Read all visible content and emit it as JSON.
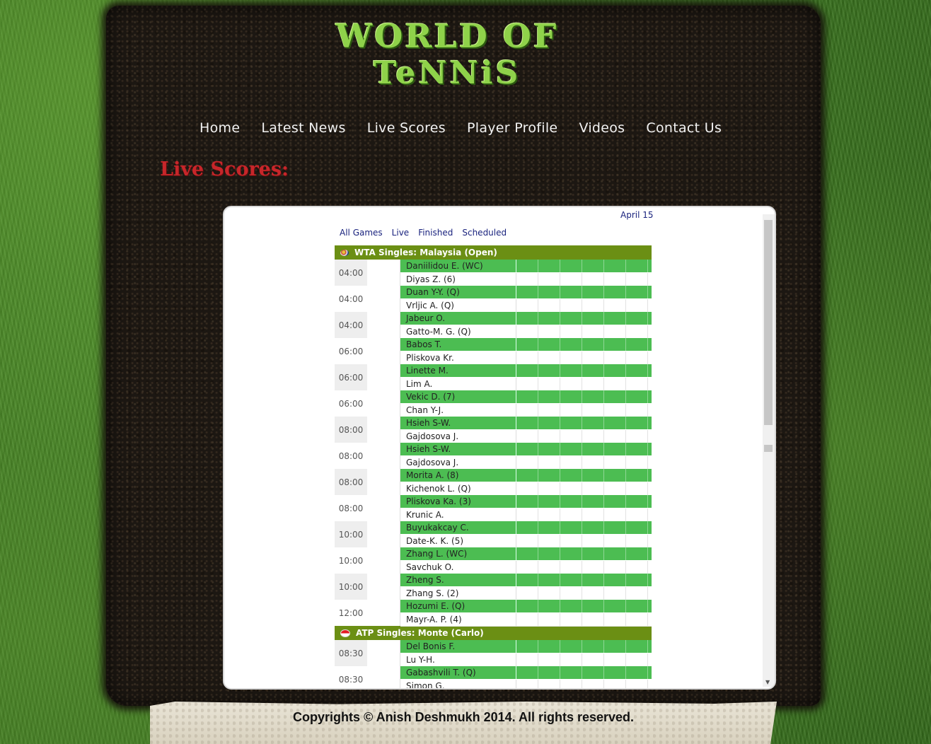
{
  "logo": {
    "line1": "WORLD OF",
    "line2": "TeNNiS"
  },
  "nav": {
    "items": [
      {
        "label": "Home"
      },
      {
        "label": "Latest News"
      },
      {
        "label": "Live Scores"
      },
      {
        "label": "Player Profile"
      },
      {
        "label": "Videos"
      },
      {
        "label": "Contact Us"
      }
    ]
  },
  "page_title": "Live Scores:",
  "widget": {
    "date": "April 15",
    "filters": [
      "All Games",
      "Live",
      "Finished",
      "Scheduled"
    ],
    "sections": [
      {
        "title": "WTA Singles: Malaysia (Open)",
        "flag": "malaysia-flag-icon",
        "matches": [
          {
            "time": "04:00",
            "p1": "Daniilidou E. (WC)",
            "p2": "Diyas Z. (6)"
          },
          {
            "time": "04:00",
            "p1": "Duan Y-Y. (Q)",
            "p2": "Vrljic A. (Q)"
          },
          {
            "time": "04:00",
            "p1": "Jabeur O.",
            "p2": "Gatto-M. G. (Q)"
          },
          {
            "time": "06:00",
            "p1": "Babos T.",
            "p2": "Pliskova Kr."
          },
          {
            "time": "06:00",
            "p1": "Linette M.",
            "p2": "Lim A."
          },
          {
            "time": "06:00",
            "p1": "Vekic D. (7)",
            "p2": "Chan Y-J."
          },
          {
            "time": "08:00",
            "p1": "Hsieh S-W.",
            "p2": "Gajdosova J."
          },
          {
            "time": "08:00",
            "p1": "Hsieh S-W.",
            "p2": "Gajdosova J."
          },
          {
            "time": "08:00",
            "p1": "Morita A. (8)",
            "p2": "Kichenok L. (Q)"
          },
          {
            "time": "08:00",
            "p1": "Pliskova Ka. (3)",
            "p2": "Krunic A."
          },
          {
            "time": "10:00",
            "p1": "Buyukakcay C.",
            "p2": "Date-K. K. (5)"
          },
          {
            "time": "10:00",
            "p1": "Zhang L. (WC)",
            "p2": "Savchuk O."
          },
          {
            "time": "10:00",
            "p1": "Zheng S.",
            "p2": "Zhang S. (2)"
          },
          {
            "time": "12:00",
            "p1": "Hozumi E. (Q)",
            "p2": "Mayr-A. P. (4)"
          }
        ]
      },
      {
        "title": "ATP Singles: Monte (Carlo)",
        "flag": "monaco-flag-icon",
        "matches": [
          {
            "time": "08:30",
            "p1": "Del Bonis F.",
            "p2": "Lu Y-H."
          },
          {
            "time": "08:30",
            "p1": "Gabashvili T. (Q)",
            "p2": "Simon G."
          }
        ]
      }
    ]
  },
  "footer": {
    "copyright": "Copyrights © Anish Deshmukh 2014. All rights reserved."
  }
}
